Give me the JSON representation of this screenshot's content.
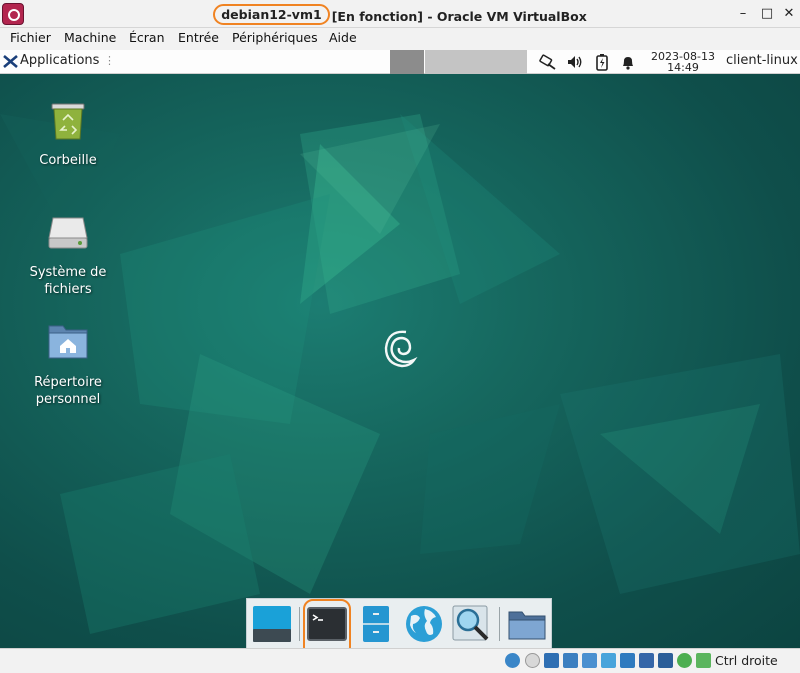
{
  "window": {
    "vm_name": "debian12-vm1",
    "title_rest": "[En fonction] - Oracle VM VirtualBox",
    "minimize": "–",
    "maximize": "□",
    "close": "✕",
    "highlight_color": "#f08322"
  },
  "menubar": {
    "items": [
      "Fichier",
      "Machine",
      "Écran",
      "Entrée",
      "Périphériques",
      "Aide"
    ]
  },
  "panel": {
    "applications_label": "Applications",
    "separator": "⋮",
    "clock_date": "2023-08-13",
    "clock_time": "14:49",
    "hostname": "client-linux",
    "tray_icons": [
      "network-icon",
      "volume-icon",
      "battery-icon",
      "notification-bell-icon"
    ]
  },
  "desktop": {
    "icons": [
      {
        "name": "trash-icon",
        "label": "Corbeille"
      },
      {
        "name": "drive-icon",
        "label": "Système de fichiers"
      },
      {
        "name": "home-folder-icon",
        "label": "Répertoire personnel"
      }
    ]
  },
  "dock": {
    "items": [
      "show-desktop-icon",
      "terminal-icon",
      "file-manager-icon",
      "web-browser-icon",
      "app-finder-icon",
      "folder-icon"
    ]
  },
  "statusbar": {
    "host_key_label": "Ctrl droite",
    "icons": [
      "hard-disk-icon",
      "optical-drive-icon",
      "audio-icon",
      "network-adapter-icon",
      "usb-icon",
      "shared-folders-icon",
      "display-icon",
      "video-capture-icon",
      "cpu-icon",
      "mouse-integration-icon",
      "keyboard-icon"
    ]
  }
}
